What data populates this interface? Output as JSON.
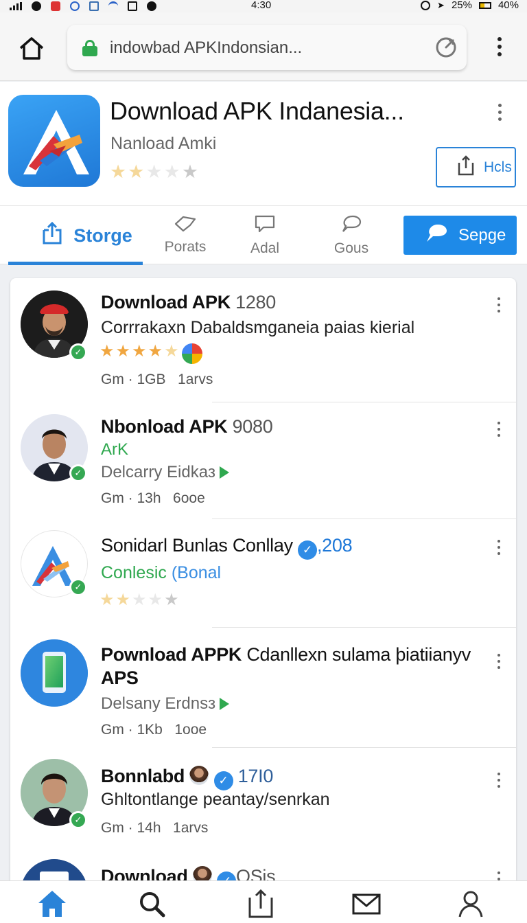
{
  "status_bar": {
    "time": "4:30",
    "battery_a": "25%",
    "battery_b": "40%"
  },
  "browser": {
    "url": "indowbad APKIndonsian..."
  },
  "app": {
    "title": "Download APK Indanesia...",
    "subtitle": "Nanload Amki",
    "rating": 2,
    "action_label": "Hcls"
  },
  "tabs": {
    "items": [
      {
        "label": "Storge",
        "icon": "share-icon",
        "active": true
      },
      {
        "label": "Porats",
        "icon": "tag-icon"
      },
      {
        "label": "Adal",
        "icon": "chat-icon"
      },
      {
        "label": "Gous",
        "icon": "speech-bubble-icon"
      }
    ],
    "primary_button": "Sepge"
  },
  "items": [
    {
      "title": "Download APK",
      "number": "1280",
      "line": "Corrrakaxn Dabaldsmganeia paias kierial",
      "rating": 4,
      "meta": "Gm · 1GB",
      "meta2": "1arvs"
    },
    {
      "title": "Nbonload APK",
      "number": "9080",
      "line1": "ArK",
      "line2": "Delcarry Eidkaз",
      "meta": "Gm · 13h",
      "meta2": "6ooe"
    },
    {
      "title": "Sonidarl",
      "title_rest": "Bunlas Conllay",
      "number": ",208",
      "line": "Conlesic",
      "line_b": "(Bonal",
      "rating": 2
    },
    {
      "title": "Pownload APPK",
      "title_rest": "Cdanllexn sulama þiatiianyv",
      "title_line2": "APS",
      "line": "Delsany Erdnsз",
      "meta": "Gm · 1Kb",
      "meta2": "1ooe"
    },
    {
      "title": "Bonnlabd",
      "number": "17I0",
      "line": "Ghltontlange peantay/senrkan",
      "meta": "Gm · 14h",
      "meta2": "1arvs"
    },
    {
      "title": "Download",
      "number": "OSis"
    }
  ],
  "bottom_nav": [
    "home-icon",
    "search-icon",
    "share-icon",
    "mail-icon",
    "profile-icon"
  ],
  "colors": {
    "accent": "#2a83d8",
    "primary_button": "#1e8ae8",
    "verified_green": "#35a853",
    "star": "#f0a640"
  }
}
